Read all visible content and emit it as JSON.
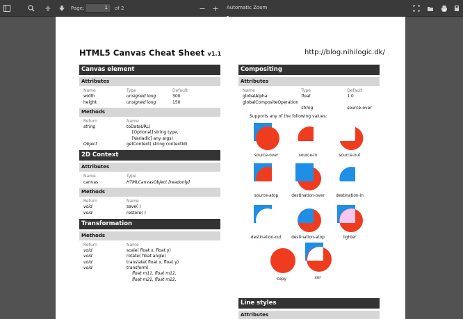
{
  "toolbar": {
    "page_label": "Page:",
    "page_value": "1",
    "page_total": "of 2",
    "zoom_out": "−",
    "zoom_in": "+",
    "zoom_value": "Automatic Zoom"
  },
  "doc": {
    "title": "HTML5 Canvas Cheat Sheet",
    "version": "v1.1",
    "url": "http://blog.nihilogic.dk/"
  },
  "canvas_element": {
    "heading": "Canvas element",
    "attributes_label": "Attributes",
    "attr_headers": [
      "Name",
      "Type",
      "Default"
    ],
    "attributes": [
      {
        "name": "width",
        "type": "unsigned long",
        "default": "300"
      },
      {
        "name": "height",
        "type": "unsigned long",
        "default": "150"
      }
    ],
    "methods_label": "Methods",
    "method_headers": [
      "Return",
      "Name"
    ],
    "methods": [
      {
        "ret": "string",
        "name": "toDataURL("
      },
      {
        "ret": "",
        "name": "[Optional] string type,"
      },
      {
        "ret": "",
        "name": "[Variadic] any args)"
      },
      {
        "ret": "Object",
        "name": "getContext( string contextId)"
      }
    ]
  },
  "context2d": {
    "heading": "2D Context",
    "attributes_label": "Attributes",
    "attr_headers": [
      "Name",
      "Type"
    ],
    "attributes": [
      {
        "name": "canvas",
        "type": "HTMLCanvasObject [readonly]"
      }
    ],
    "methods_label": "Methods",
    "method_headers": [
      "Return",
      "Name"
    ],
    "methods": [
      {
        "ret": "void",
        "name": "save( )"
      },
      {
        "ret": "void",
        "name": "restore( )"
      }
    ]
  },
  "transformation": {
    "heading": "Transformation",
    "methods_label": "Methods",
    "method_headers": [
      "Return",
      "Name"
    ],
    "methods": [
      {
        "ret": "void",
        "name": "scale( float x, float y)"
      },
      {
        "ret": "void",
        "name": "rotate( float angle)"
      },
      {
        "ret": "void",
        "name": "translate( float x, float y)"
      },
      {
        "ret": "void",
        "name": "transform("
      },
      {
        "ret": "",
        "name": "float m11, float m12,"
      },
      {
        "ret": "",
        "name": "float m21, float m22,"
      }
    ]
  },
  "compositing": {
    "heading": "Compositing",
    "attributes_label": "Attributes",
    "attr_headers": [
      "Name",
      "Type",
      "Default"
    ],
    "attributes": [
      {
        "name": "globalAlpha",
        "type": "float",
        "default": "1.0"
      },
      {
        "name": "globalCompositeOperation",
        "type": "",
        "default": ""
      },
      {
        "name": "",
        "type": "string",
        "default": "source-over"
      }
    ],
    "supports": "Supports any of the following values:",
    "ops": [
      "source-over",
      "source-in",
      "source-out",
      "source-atop",
      "destination-over",
      "destination-in",
      "destination-out",
      "destination-atop",
      "lighter",
      "copy",
      "xor"
    ],
    "colors": {
      "red": "#f03c1e",
      "blue": "#1e8ee6",
      "pink": "#f4c6f0"
    }
  },
  "line_styles": {
    "heading": "Line styles",
    "attributes_label": "Attributes"
  }
}
